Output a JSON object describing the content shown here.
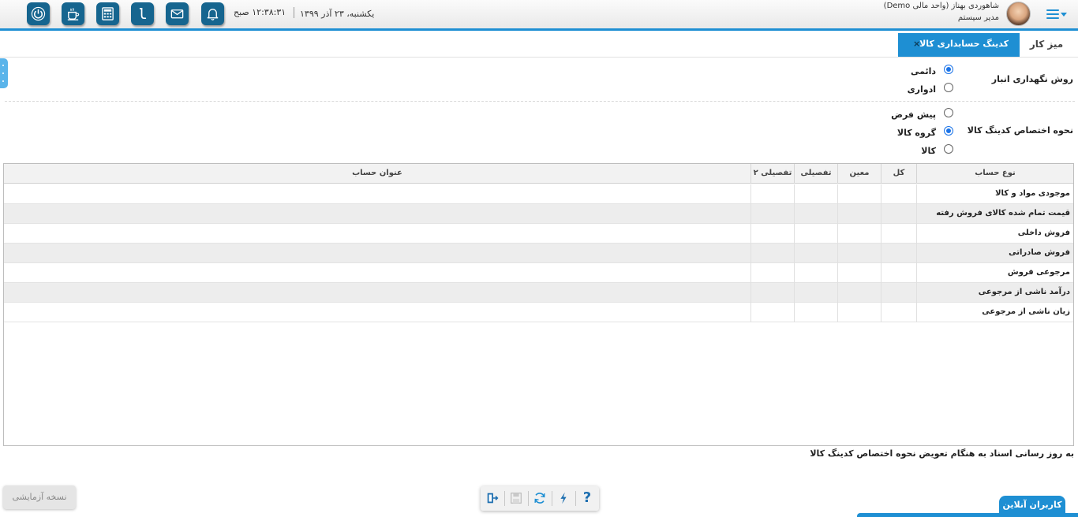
{
  "header": {
    "user_name": "شاهوردی بهناز (واحد مالی Demo)",
    "user_role": "مدیر سیستم",
    "time": "۱۲:۳۸:۳۱ صبح",
    "date": "یکشنبه، ۲۳ آذر ۱۳۹۹",
    "icons": [
      "power-icon",
      "coffee-icon",
      "calculator-icon",
      "phone-icon",
      "mail-icon",
      "bell-icon"
    ]
  },
  "tabs": {
    "desk": "میز کار",
    "active": "کدینگ حسابداری کالا",
    "close": "×"
  },
  "form": {
    "inventory_method": {
      "label": "روش نگهداری انبار",
      "options": [
        "دائمی",
        "ادواری"
      ],
      "selected": "دائمی"
    },
    "coding_method": {
      "label": "نحوه اختصاص کدینگ کالا",
      "options": [
        "پیش فرض",
        "گروه کالا",
        "کالا"
      ],
      "selected": "گروه کالا"
    }
  },
  "grid": {
    "columns": [
      "نوع حساب",
      "کل",
      "معین",
      "تفصیلی",
      "تفصیلی ۲",
      "عنوان حساب"
    ],
    "rows": [
      "موجودی مواد و کالا",
      "قیمت تمام شده کالای فروش رفته",
      "فروش داخلی",
      "فروش صادراتی",
      "مرجوعی فروش",
      "درآمد ناشی از مرجوعی",
      "زیان ناشی از مرجوعی"
    ]
  },
  "update_docs_label": "به روز رسانی اسناد به هنگام تعویض نحوه اختصاص کدینگ کالا",
  "footer": {
    "demo_badge": "نسخه آزمایشی",
    "online_users": "کاربران آنلاین",
    "toolbar": [
      "exit-icon",
      "save-icon",
      "refresh-icon",
      "flash-icon",
      "help-icon"
    ],
    "help_label": "?"
  },
  "colors": {
    "accent": "#1e8fd3",
    "icon_bg": "#16658f"
  }
}
